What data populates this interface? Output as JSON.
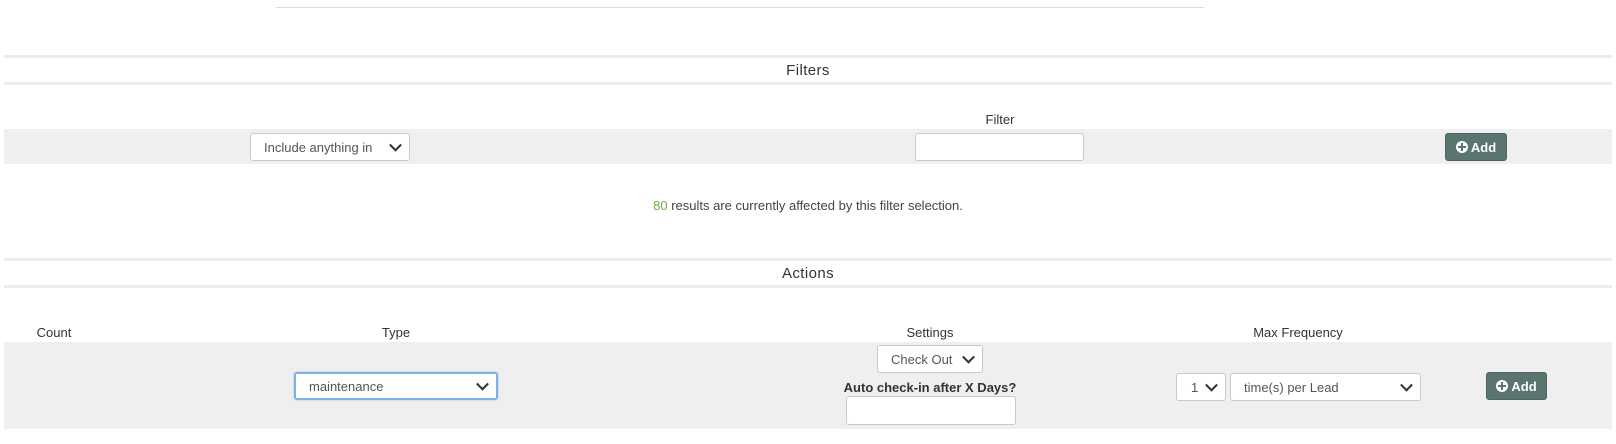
{
  "sections": {
    "filters": {
      "title": "Filters"
    },
    "actions": {
      "title": "Actions"
    }
  },
  "filters": {
    "column_header": "Filter",
    "mode_select": {
      "value": "Include anything in"
    },
    "filter_input": {
      "value": ""
    },
    "add_button": {
      "label": "Add",
      "icon": "plus-circle-icon"
    },
    "result": {
      "count": "80",
      "text": " results are currently affected by this filter selection."
    }
  },
  "actions": {
    "headers": {
      "count": "Count",
      "type": "Type",
      "settings": "Settings",
      "max_frequency": "Max Frequency"
    },
    "type_select": {
      "value": "maintenance"
    },
    "settings_select": {
      "value": "Check Out"
    },
    "auto_checkin_label": "Auto check-in after X Days?",
    "auto_checkin_input": {
      "value": ""
    },
    "frequency_count_select": {
      "value": "1"
    },
    "frequency_unit_select": {
      "value": "time(s) per Lead"
    },
    "add_button": {
      "label": "Add",
      "icon": "plus-circle-icon"
    }
  },
  "colors": {
    "button": "#5a7470",
    "highlight_count": "#6aae3f",
    "row_band": "#efefef"
  }
}
